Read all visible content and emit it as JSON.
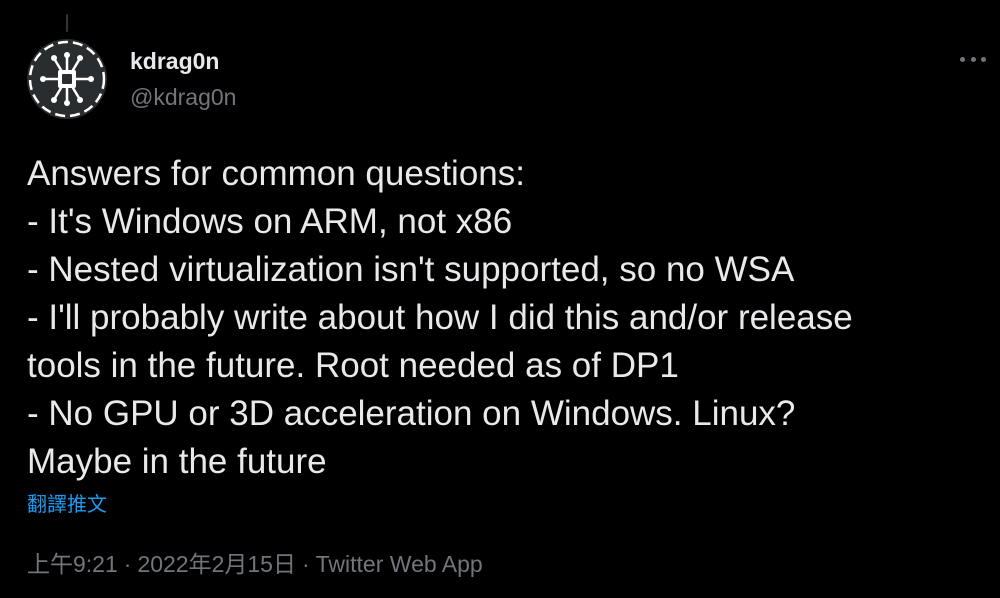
{
  "author": {
    "display_name": "kdrag0n",
    "handle": "@kdrag0n",
    "avatar_icon": "chip-circuit-icon"
  },
  "menu": {
    "icon": "more-horizontal-icon"
  },
  "tweet": {
    "lines": [
      "Answers for common questions:",
      "- It's Windows on ARM, not x86",
      "- Nested virtualization isn't supported, so no WSA",
      "- I'll probably write about how I did this and/or release",
      "tools in the future. Root needed as of DP1",
      "- No GPU or 3D acceleration on Windows. Linux?",
      "Maybe in the future"
    ],
    "translate_label": "翻譯推文"
  },
  "meta": {
    "time": "上午9:21",
    "separator": "·",
    "date": "2022年2月15日",
    "source": "Twitter Web App"
  },
  "colors": {
    "background": "#000000",
    "primary_text": "#e7e9ea",
    "secondary_text": "#71767b",
    "link": "#1d9bf0"
  }
}
